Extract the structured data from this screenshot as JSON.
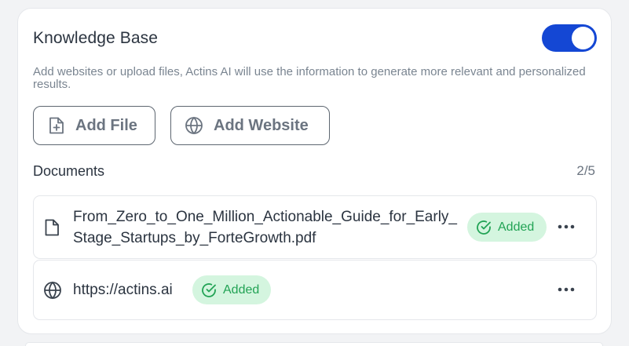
{
  "knowledge_base": {
    "title": "Knowledge Base",
    "enabled": true,
    "description": "Add websites or upload files, Actins AI will use the information to generate more relevant and personalized results.",
    "add_file_label": "Add File",
    "add_website_label": "Add Website"
  },
  "documents": {
    "title": "Documents",
    "count": "2/5",
    "items": [
      {
        "name": "From_Zero_to_One_Million_Actionable_Guide_for_Early_Stage_Startups_by_ForteGrowth.pdf",
        "status": "Added",
        "icon": "file-icon"
      },
      {
        "name": "https://actins.ai",
        "status": "Added",
        "icon": "globe-icon"
      }
    ]
  },
  "colors": {
    "accent": "#1447d4",
    "badge_bg": "#d4f5df",
    "badge_text": "#22a355"
  }
}
